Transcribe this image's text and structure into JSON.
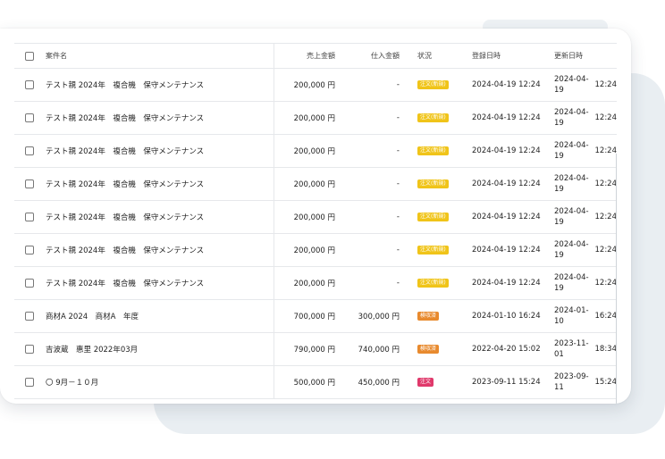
{
  "columns": {
    "name": "案件名",
    "sales": "売上金額",
    "cost": "仕入金額",
    "status": "状況",
    "created": "登録日時",
    "updated": "更新日時"
  },
  "rows": [
    {
      "name": "テスト親 2024年　複合機　保守メンテナンス",
      "sales": "200,000 円",
      "cost": "-",
      "status": "注文(新規)",
      "status_color": "#f0c419",
      "created": "2024-04-19 12:24",
      "updated": "2024-04-19 12:24"
    },
    {
      "name": "テスト親 2024年　複合機　保守メンテナンス",
      "sales": "200,000 円",
      "cost": "-",
      "status": "注文(新規)",
      "status_color": "#f0c419",
      "created": "2024-04-19 12:24",
      "updated": "2024-04-19 12:24"
    },
    {
      "name": "テスト親 2024年　複合機　保守メンテナンス",
      "sales": "200,000 円",
      "cost": "-",
      "status": "注文(新規)",
      "status_color": "#f0c419",
      "created": "2024-04-19 12:24",
      "updated": "2024-04-19 12:24"
    },
    {
      "name": "テスト親 2024年　複合機　保守メンテナンス",
      "sales": "200,000 円",
      "cost": "-",
      "status": "注文(新規)",
      "status_color": "#f0c419",
      "created": "2024-04-19 12:24",
      "updated": "2024-04-19 12:24"
    },
    {
      "name": "テスト親 2024年　複合機　保守メンテナンス",
      "sales": "200,000 円",
      "cost": "-",
      "status": "注文(新規)",
      "status_color": "#f0c419",
      "created": "2024-04-19 12:24",
      "updated": "2024-04-19 12:24"
    },
    {
      "name": "テスト親 2024年　複合機　保守メンテナンス",
      "sales": "200,000 円",
      "cost": "-",
      "status": "注文(新規)",
      "status_color": "#f0c419",
      "created": "2024-04-19 12:24",
      "updated": "2024-04-19 12:24"
    },
    {
      "name": "テスト親 2024年　複合機　保守メンテナンス",
      "sales": "200,000 円",
      "cost": "-",
      "status": "注文(新規)",
      "status_color": "#f0c419",
      "created": "2024-04-19 12:24",
      "updated": "2024-04-19 12:24"
    },
    {
      "name": "商材A 2024　商材A　年度",
      "sales": "700,000 円",
      "cost": "300,000 円",
      "status": "検収済",
      "status_color": "#e88a2e",
      "created": "2024-01-10 16:24",
      "updated": "2024-01-10 16:24"
    },
    {
      "name": "吉波蔵　惠里 2022年03月",
      "sales": "790,000 円",
      "cost": "740,000 円",
      "status": "検収済",
      "status_color": "#e88a2e",
      "created": "2022-04-20 15:02",
      "updated": "2023-11-01 18:34"
    },
    {
      "name": "〇 9月－１０月",
      "sales": "500,000 円",
      "cost": "450,000 円",
      "status": "注文",
      "status_color": "#e0396b",
      "created": "2023-09-11 15:24",
      "updated": "2023-09-11 15:24"
    }
  ]
}
